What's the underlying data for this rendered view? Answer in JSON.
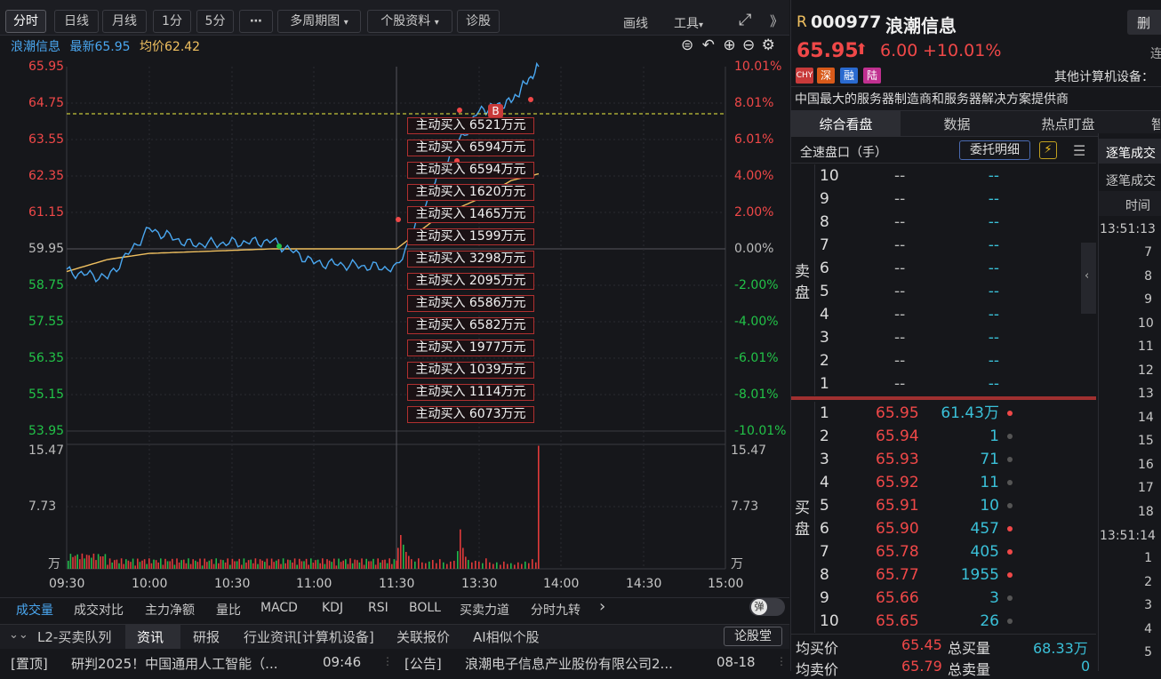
{
  "toolbar": {
    "buttons": [
      "分时",
      "日线",
      "月线",
      "1分",
      "5分",
      "⋯",
      "多周期图",
      "个股资料",
      "诊股"
    ],
    "draw": "画线",
    "tools": "工具",
    "expand": "⤢",
    "collapse": "》"
  },
  "info": {
    "name": "浪潮信息",
    "latest_label": "最新",
    "latest": "65.95",
    "avg_label": "均价",
    "avg": "62.42"
  },
  "price_axis": {
    "left": [
      "65.95",
      "64.75",
      "63.55",
      "62.35",
      "61.15",
      "59.95",
      "58.75",
      "57.55",
      "56.35",
      "55.15",
      "53.95"
    ],
    "right": [
      "10.01%",
      "8.01%",
      "6.01%",
      "4.00%",
      "2.00%",
      "0.00%",
      "-2.00%",
      "-4.00%",
      "-6.01%",
      "-8.01%",
      "-10.01%"
    ]
  },
  "volume_axis": {
    "left": [
      "15.47",
      "7.73",
      "万"
    ],
    "right": [
      "15.47",
      "7.73",
      "万"
    ]
  },
  "time_axis": [
    "09:30",
    "10:00",
    "10:30",
    "11:00",
    "11:30",
    "13:30",
    "14:00",
    "14:30",
    "15:00"
  ],
  "markers": {
    "b_label": "B",
    "tags": [
      "主动买入 6521万元",
      "主动买入 6594万元",
      "主动买入 6594万元",
      "主动买入 1620万元",
      "主动买入 1465万元",
      "主动买入 1599万元",
      "主动买入 3298万元",
      "主动买入 2095万元",
      "主动买入 6586万元",
      "主动买入 6582万元",
      "主动买入 1977万元",
      "主动买入 1039万元",
      "主动买入 1114万元",
      "主动买入 6073万元"
    ]
  },
  "chart_data": {
    "type": "line",
    "x": [
      "09:30",
      "09:45",
      "10:00",
      "10:15",
      "10:30",
      "10:45",
      "11:00",
      "11:15",
      "11:30",
      "13:00",
      "13:15",
      "13:30",
      "13:45"
    ],
    "series": [
      {
        "values": [
          59.2,
          59.0,
          60.6,
          60.1,
          60.15,
          60.2,
          59.5,
          59.4,
          59.3,
          62.4,
          64.5,
          64.8,
          65.95
        ]
      },
      {
        "values": [
          59.2,
          59.6,
          59.8,
          59.85,
          59.9,
          59.95,
          59.95,
          59.95,
          59.95,
          61.0,
          61.6,
          62.2,
          62.42
        ]
      }
    ],
    "ylim": [
      53.95,
      65.95
    ],
    "reference_price": 59.95,
    "volume_ylim": [
      0,
      15.47
    ],
    "colors": {
      "price": "#4aa7f0",
      "avg": "#f0c060",
      "ref": "#f0f040",
      "vol_up": "#e03a3a",
      "vol_down": "#22b84a"
    }
  },
  "indicators": [
    "成交量",
    "成交对比",
    "主力净额",
    "量比",
    "MACD",
    "KDJ",
    "RSI",
    "BOLL",
    "买卖力道",
    "分时九转",
    "›"
  ],
  "toggle_label": "弹",
  "bottom_tabs": [
    "L2-买卖队列",
    "资讯",
    "研报",
    "行业资讯[计算机设备]",
    "关联报价",
    "AI相似个股"
  ],
  "forum_button": "论股堂",
  "news": [
    {
      "tag": "[置顶]",
      "title": "研判2025！中国通用人工智能（...",
      "time": "09:46"
    },
    {
      "tag": "[公告]",
      "title": "浪潮电子信息产业股份有限公司2...",
      "time": "08-18"
    }
  ],
  "quote": {
    "prefix": "R",
    "code": "000977",
    "name": "浪潮信息",
    "price": "65.95",
    "change": "6.00",
    "change_pct": "+10.01%",
    "right_btn": "删",
    "right_btn2": "连",
    "badges": [
      "CHY",
      "深",
      "融",
      "陆"
    ],
    "industry": "其他计算机设备：",
    "desc": "中国最大的服务器制造商和服务器解决方案提供商"
  },
  "right_tabs": [
    "综合看盘",
    "数据",
    "热点盯盘",
    "智"
  ],
  "orderbook": {
    "title": "全速盘口（手）",
    "detail_btn": "委托明细",
    "sell_label": [
      "卖",
      "盘"
    ],
    "buy_label": [
      "买",
      "盘"
    ],
    "sell": [
      {
        "lvl": "10",
        "price": "--",
        "vol": "--"
      },
      {
        "lvl": "9",
        "price": "--",
        "vol": "--"
      },
      {
        "lvl": "8",
        "price": "--",
        "vol": "--"
      },
      {
        "lvl": "7",
        "price": "--",
        "vol": "--"
      },
      {
        "lvl": "6",
        "price": "--",
        "vol": "--"
      },
      {
        "lvl": "5",
        "price": "--",
        "vol": "--"
      },
      {
        "lvl": "4",
        "price": "--",
        "vol": "--"
      },
      {
        "lvl": "3",
        "price": "--",
        "vol": "--"
      },
      {
        "lvl": "2",
        "price": "--",
        "vol": "--"
      },
      {
        "lvl": "1",
        "price": "--",
        "vol": "--"
      }
    ],
    "buy": [
      {
        "lvl": "1",
        "price": "65.95",
        "vol": "61.43万"
      },
      {
        "lvl": "2",
        "price": "65.94",
        "vol": "1"
      },
      {
        "lvl": "3",
        "price": "65.93",
        "vol": "71"
      },
      {
        "lvl": "4",
        "price": "65.92",
        "vol": "11"
      },
      {
        "lvl": "5",
        "price": "65.91",
        "vol": "10"
      },
      {
        "lvl": "6",
        "price": "65.90",
        "vol": "457"
      },
      {
        "lvl": "7",
        "price": "65.78",
        "vol": "405"
      },
      {
        "lvl": "8",
        "price": "65.77",
        "vol": "1955"
      },
      {
        "lvl": "9",
        "price": "65.66",
        "vol": "3"
      },
      {
        "lvl": "10",
        "price": "65.65",
        "vol": "26"
      }
    ],
    "avg_buy_label": "均买价",
    "avg_buy": "65.45",
    "total_buy_label": "总买量",
    "total_buy": "68.33万",
    "avg_sell_label": "均卖价",
    "avg_sell": "65.79",
    "total_sell_label": "总卖量",
    "total_sell": "0"
  },
  "trades": {
    "tab1": "逐笔成交",
    "tab2": "逐笔成交",
    "time_header": "时间",
    "time1": "13:51:13",
    "rows1": [
      "7",
      "8",
      "9",
      "10",
      "11",
      "12",
      "13",
      "14",
      "15",
      "16",
      "17",
      "18"
    ],
    "time2": "13:51:14",
    "rows2": [
      "1",
      "2",
      "3",
      "4",
      "5"
    ]
  }
}
